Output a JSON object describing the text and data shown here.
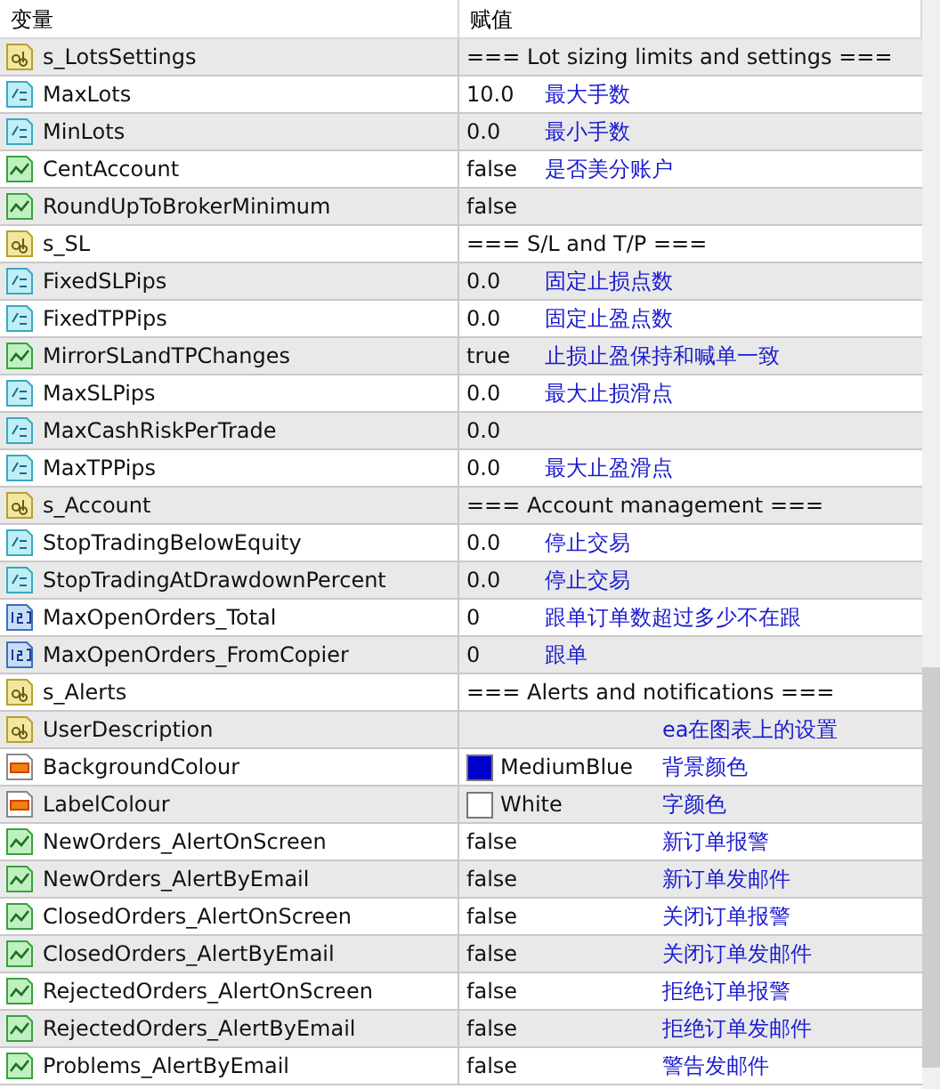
{
  "columns": [
    "变量",
    "赋值"
  ],
  "rows": [
    {
      "kind": "string",
      "name": "s_LotsSettings",
      "value": "=== Lot sizing limits and settings ==="
    },
    {
      "kind": "double",
      "name": "MaxLots",
      "value": "10.0",
      "note": "最大手数"
    },
    {
      "kind": "double",
      "name": "MinLots",
      "value": "0.0",
      "note": "最小手数"
    },
    {
      "kind": "bool",
      "name": "CentAccount",
      "value": "false",
      "note": "是否美分账户"
    },
    {
      "kind": "bool",
      "name": "RoundUpToBrokerMinimum",
      "value": "false"
    },
    {
      "kind": "string",
      "name": "s_SL",
      "value": "=== S/L and T/P ==="
    },
    {
      "kind": "double",
      "name": "FixedSLPips",
      "value": "0.0",
      "note": "固定止损点数"
    },
    {
      "kind": "double",
      "name": "FixedTPPips",
      "value": "0.0",
      "note": "固定止盈点数"
    },
    {
      "kind": "bool",
      "name": "MirrorSLandTPChanges",
      "value": "true",
      "note": "止损止盈保持和喊单一致"
    },
    {
      "kind": "double",
      "name": "MaxSLPips",
      "value": "0.0",
      "note": "最大止损滑点"
    },
    {
      "kind": "double",
      "name": "MaxCashRiskPerTrade",
      "value": "0.0"
    },
    {
      "kind": "double",
      "name": "MaxTPPips",
      "value": "0.0",
      "note": "最大止盈滑点"
    },
    {
      "kind": "string",
      "name": "s_Account",
      "value": "=== Account management ==="
    },
    {
      "kind": "double",
      "name": "StopTradingBelowEquity",
      "value": "0.0",
      "note": "停止交易"
    },
    {
      "kind": "double",
      "name": "StopTradingAtDrawdownPercent",
      "value": "0.0",
      "note": "停止交易"
    },
    {
      "kind": "int",
      "name": "MaxOpenOrders_Total",
      "value": "0",
      "note": "跟单订单数超过多少不在跟"
    },
    {
      "kind": "int",
      "name": "MaxOpenOrders_FromCopier",
      "value": "0",
      "note": "跟单"
    },
    {
      "kind": "string",
      "name": "s_Alerts",
      "value": "=== Alerts and notifications ==="
    },
    {
      "kind": "string",
      "name": "UserDescription",
      "note": "ea在图表上的设置"
    },
    {
      "kind": "color",
      "name": "BackgroundColour",
      "value": "MediumBlue",
      "color": "#0000cd",
      "note": "背景颜色"
    },
    {
      "kind": "color",
      "name": "LabelColour",
      "value": "White",
      "color": "#ffffff",
      "note": "字颜色"
    },
    {
      "kind": "bool",
      "name": "NewOrders_AlertOnScreen",
      "value": "false",
      "note": "新订单报警"
    },
    {
      "kind": "bool",
      "name": "NewOrders_AlertByEmail",
      "value": "false",
      "note": "新订单发邮件"
    },
    {
      "kind": "bool",
      "name": "ClosedOrders_AlertOnScreen",
      "value": "false",
      "note": "关闭订单报警"
    },
    {
      "kind": "bool",
      "name": "ClosedOrders_AlertByEmail",
      "value": "false",
      "note": "关闭订单发邮件"
    },
    {
      "kind": "bool",
      "name": "RejectedOrders_AlertOnScreen",
      "value": "false",
      "note": "拒绝订单报警"
    },
    {
      "kind": "bool",
      "name": "RejectedOrders_AlertByEmail",
      "value": "false",
      "note": "拒绝订单发邮件"
    },
    {
      "kind": "bool",
      "name": "Problems_AlertByEmail",
      "value": "false",
      "note": "警告发邮件"
    }
  ]
}
